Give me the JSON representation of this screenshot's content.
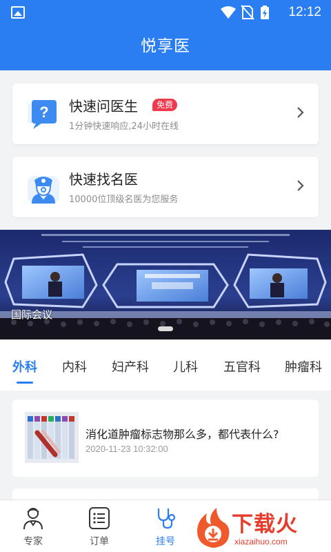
{
  "status_bar": {
    "time": "12:12"
  },
  "header": {
    "title": "悦享医"
  },
  "cards": [
    {
      "title": "快速问医生",
      "badge": "免费",
      "subtitle": "1分钟快速响应,24小时在线",
      "icon": "chat-question-icon"
    },
    {
      "title": "快速找名医",
      "subtitle": "10000位顶级名医为您服务",
      "icon": "doctor-icon"
    }
  ],
  "banner": {
    "label": "国际会议",
    "slide_count": 1,
    "active_slide": 1
  },
  "tabs": [
    {
      "label": "外科",
      "active": true
    },
    {
      "label": "内科"
    },
    {
      "label": "妇产科"
    },
    {
      "label": "儿科"
    },
    {
      "label": "五官科"
    },
    {
      "label": "肿瘤科"
    }
  ],
  "articles": [
    {
      "title": "消化道肿瘤标志物那么多，都代表什么?",
      "date": "2020-11-23 10:32:00"
    }
  ],
  "bottom_nav": [
    {
      "label": "专家",
      "icon": "doctor-avatar-icon"
    },
    {
      "label": "订单",
      "icon": "order-list-icon"
    },
    {
      "label": "挂号",
      "icon": "stethoscope-icon",
      "active": true
    }
  ],
  "watermark": {
    "text": "下载火",
    "url": "xiazaihuo.com"
  },
  "colors": {
    "primary": "#2a7ef2",
    "badge": "#f2394b",
    "watermark": "#e63c2b"
  }
}
